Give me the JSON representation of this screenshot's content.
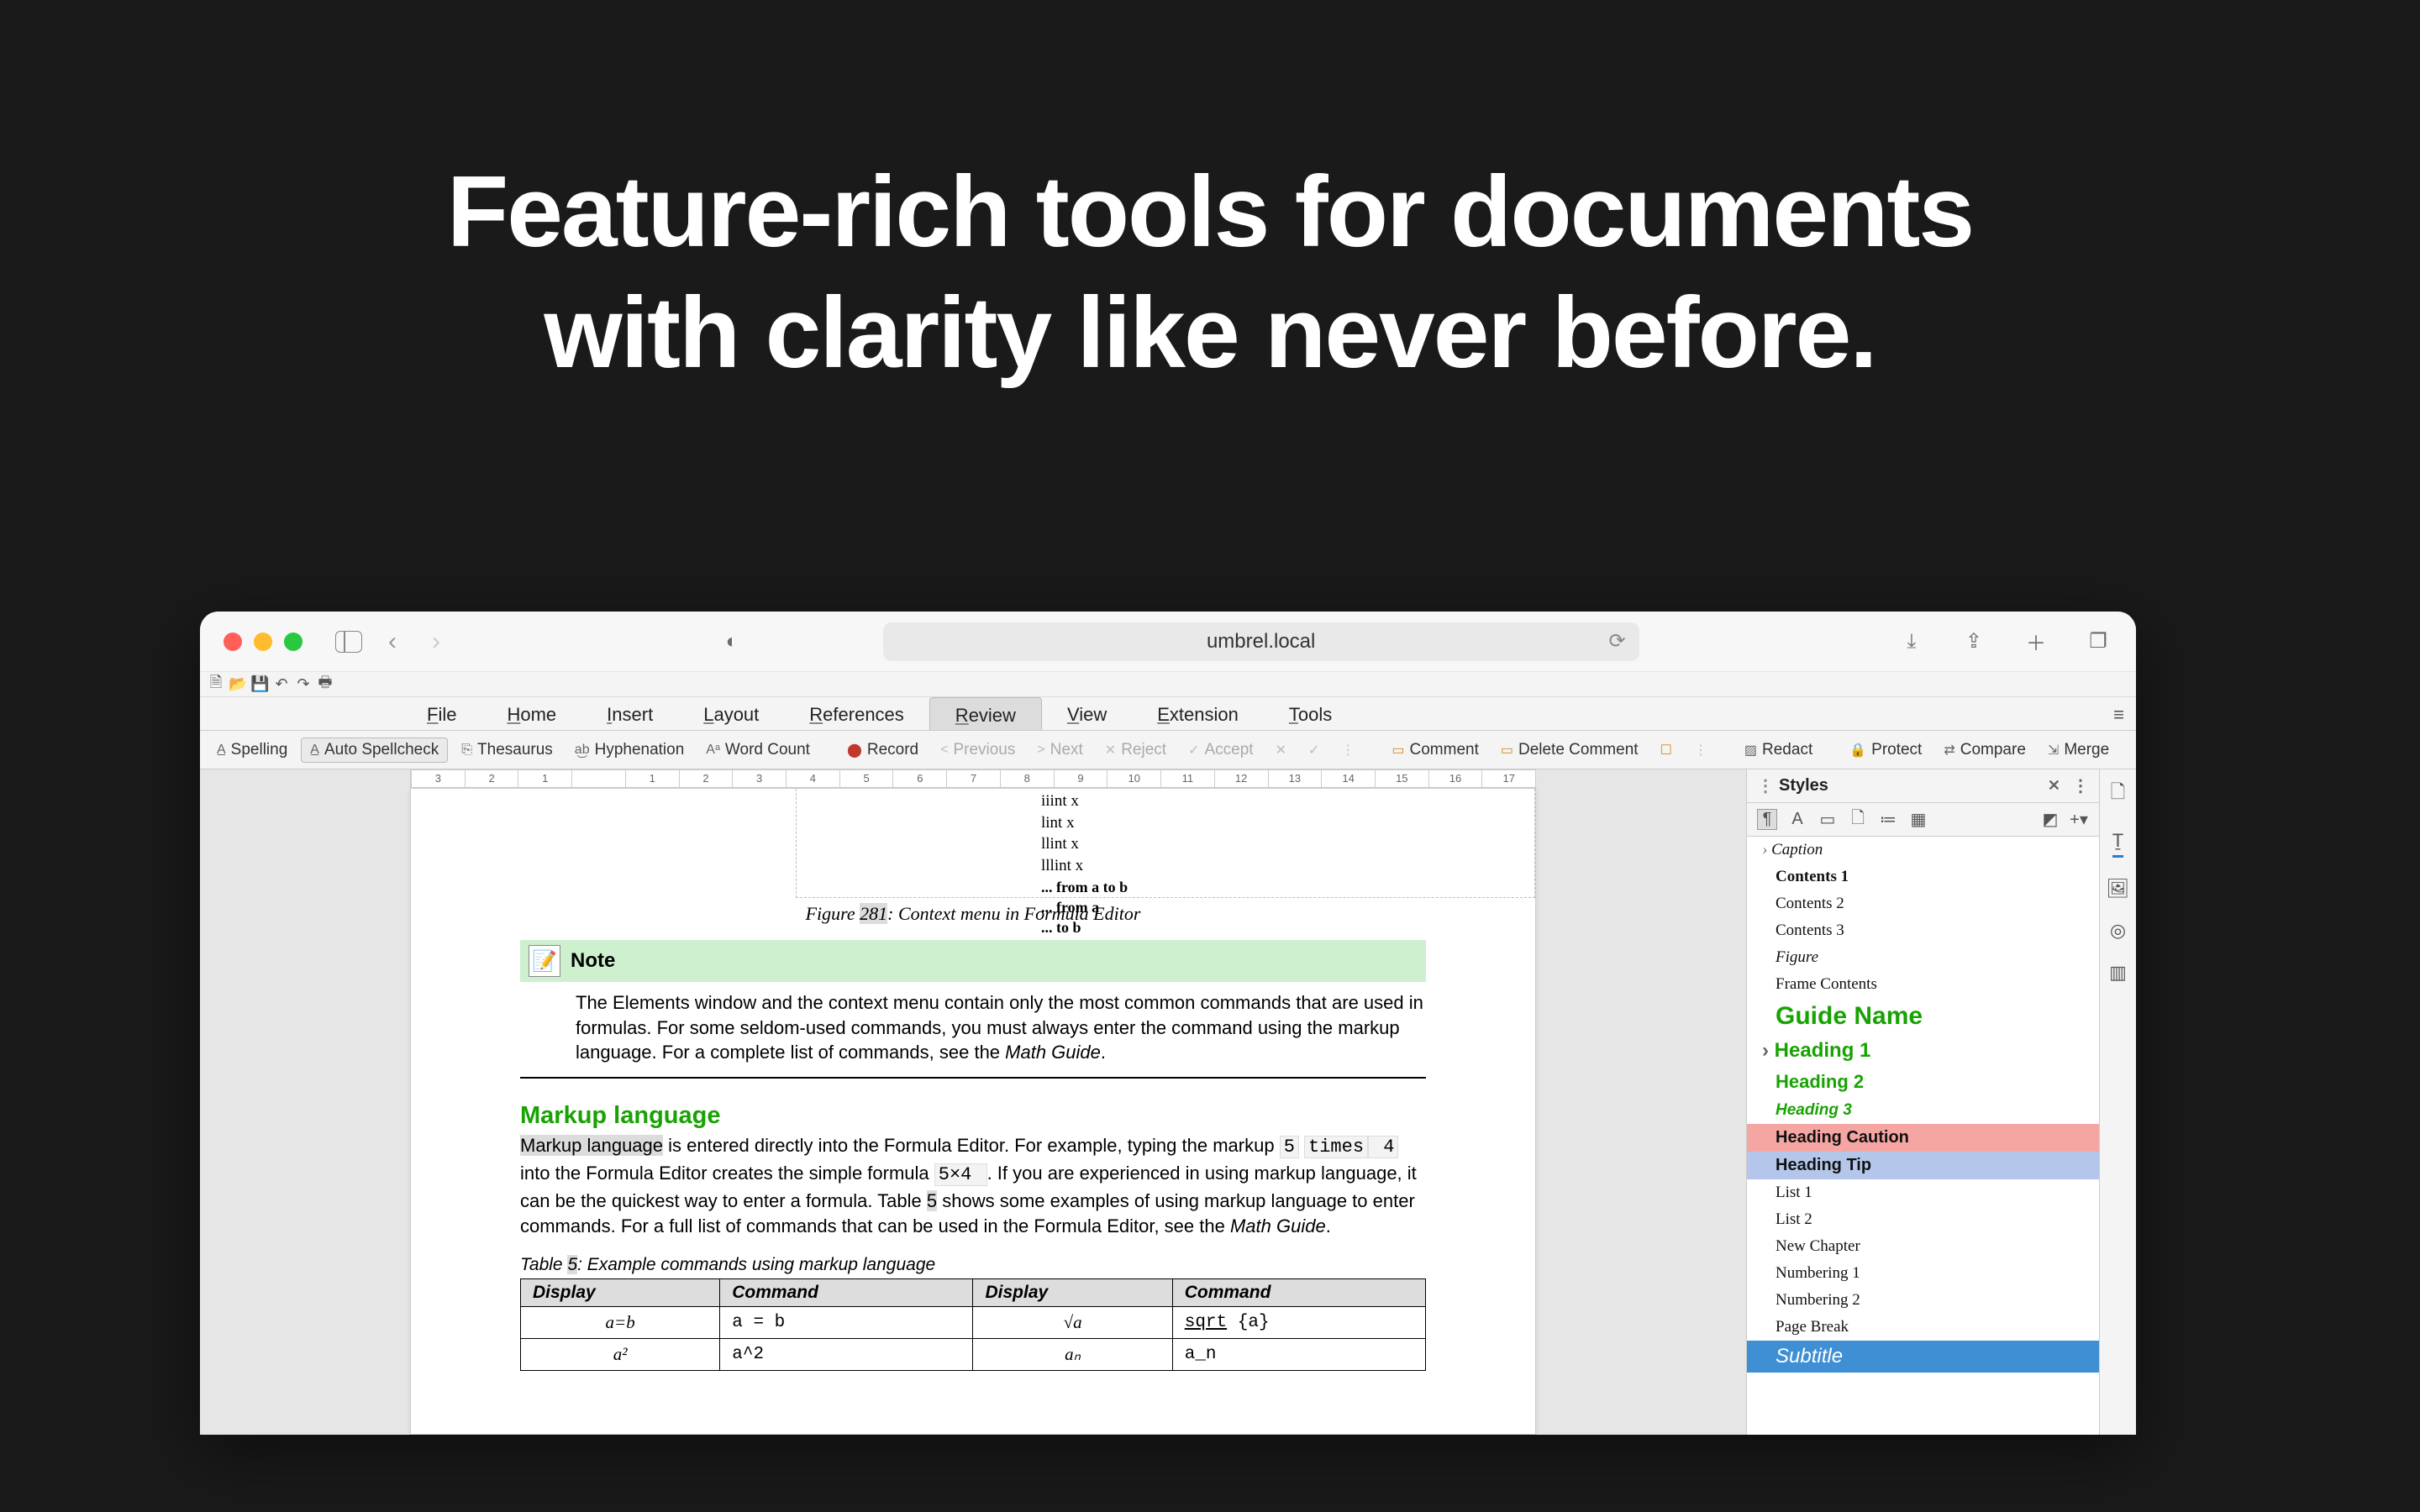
{
  "headline_l1": "Feature-rich tools for documents",
  "headline_l2": "with clarity like never before.",
  "browser": {
    "url": "umbrel.local"
  },
  "menu_tabs": [
    "File",
    "Home",
    "Insert",
    "Layout",
    "References",
    "Review",
    "View",
    "Extension",
    "Tools"
  ],
  "active_tab_index": 5,
  "ribbon": {
    "spelling": "Spelling",
    "auto": "Auto Spellcheck",
    "thesaurus": "Thesaurus",
    "hyphen": "Hyphenation",
    "wordcount": "Word Count",
    "record": "Record",
    "previous": "Previous",
    "next": "Next",
    "reject": "Reject",
    "accept": "Accept",
    "comment": "Comment",
    "delcomment": "Delete Comment",
    "redact": "Redact",
    "protect": "Protect",
    "compare": "Compare",
    "merge": "Merge",
    "review": "Review"
  },
  "ruler_marks": [
    "3",
    "2",
    "1",
    "",
    "1",
    "2",
    "3",
    "4",
    "5",
    "6",
    "7",
    "8",
    "9",
    "10",
    "11",
    "12",
    "13",
    "14",
    "15",
    "16",
    "17"
  ],
  "context_items": [
    "iiint x",
    "lint x",
    "llint x",
    "lllint x",
    "... from a to b",
    "... from a",
    "... to b"
  ],
  "figure": {
    "pre": "Figure ",
    "num": "281",
    "post": ": Context menu in Formula Editor"
  },
  "note": {
    "title": "Note",
    "body_1": "The Elements window and the context menu contain only the most common commands that are used in formulas. For some seldom-used commands, you must always enter the command using the markup language. For a complete list of commands, see the ",
    "body_em": "Math Guide",
    "body_2": "."
  },
  "heading": "Markup language",
  "para": {
    "hl": "Markup language",
    "t1": " is entered directly into the Formula Editor. For example, typing the markup ",
    "c1": "5",
    "sp": " ",
    "c2": "times",
    "c3": " 4",
    "t2": " into the Formula Editor creates the simple formula ",
    "c4": " 5×4 ",
    "t3": ". If you are experienced in using markup language, it can be the quickest way to enter a formula. Table ",
    "hl2": "5",
    "t4": " shows some examples of using markup language to enter commands. For a full list of commands that can be used in the Formula Editor, see the ",
    "em": "Math Guide",
    "t5": "."
  },
  "table": {
    "caption_pre": "Table ",
    "caption_num": "5",
    "caption_post": ": Example commands using markup language",
    "headers": [
      "Display",
      "Command",
      "Display",
      "Command"
    ],
    "rows": [
      [
        "a=b",
        "a = b",
        "√a",
        "sqrt {a}"
      ],
      [
        "a²",
        "a^2",
        "aₙ",
        "a_n"
      ]
    ]
  },
  "styles": {
    "title": "Styles",
    "items": [
      {
        "label": "Caption",
        "cls": "italic small caret"
      },
      {
        "label": "Contents 1",
        "cls": "bold small",
        "bold": true
      },
      {
        "label": "Contents 2",
        "cls": "small"
      },
      {
        "label": "Contents 3",
        "cls": "small"
      },
      {
        "label": "Figure",
        "cls": "italic small"
      },
      {
        "label": "Frame Contents",
        "cls": "small"
      },
      {
        "label": "Guide Name",
        "cls": "guide"
      },
      {
        "label": "Heading 1",
        "cls": "h1 caret"
      },
      {
        "label": "Heading 2",
        "cls": "h2"
      },
      {
        "label": "Heading 3",
        "cls": "h3"
      },
      {
        "label": "Heading Caution",
        "cls": "caution"
      },
      {
        "label": "Heading Tip",
        "cls": "tip"
      },
      {
        "label": "List 1",
        "cls": "small"
      },
      {
        "label": "List 2",
        "cls": "small"
      },
      {
        "label": "New Chapter",
        "cls": "small"
      },
      {
        "label": "Numbering 1",
        "cls": "small"
      },
      {
        "label": "Numbering 2",
        "cls": "small"
      },
      {
        "label": "Page Break",
        "cls": "small"
      },
      {
        "label": "Subtitle",
        "cls": "subtitle"
      }
    ]
  }
}
